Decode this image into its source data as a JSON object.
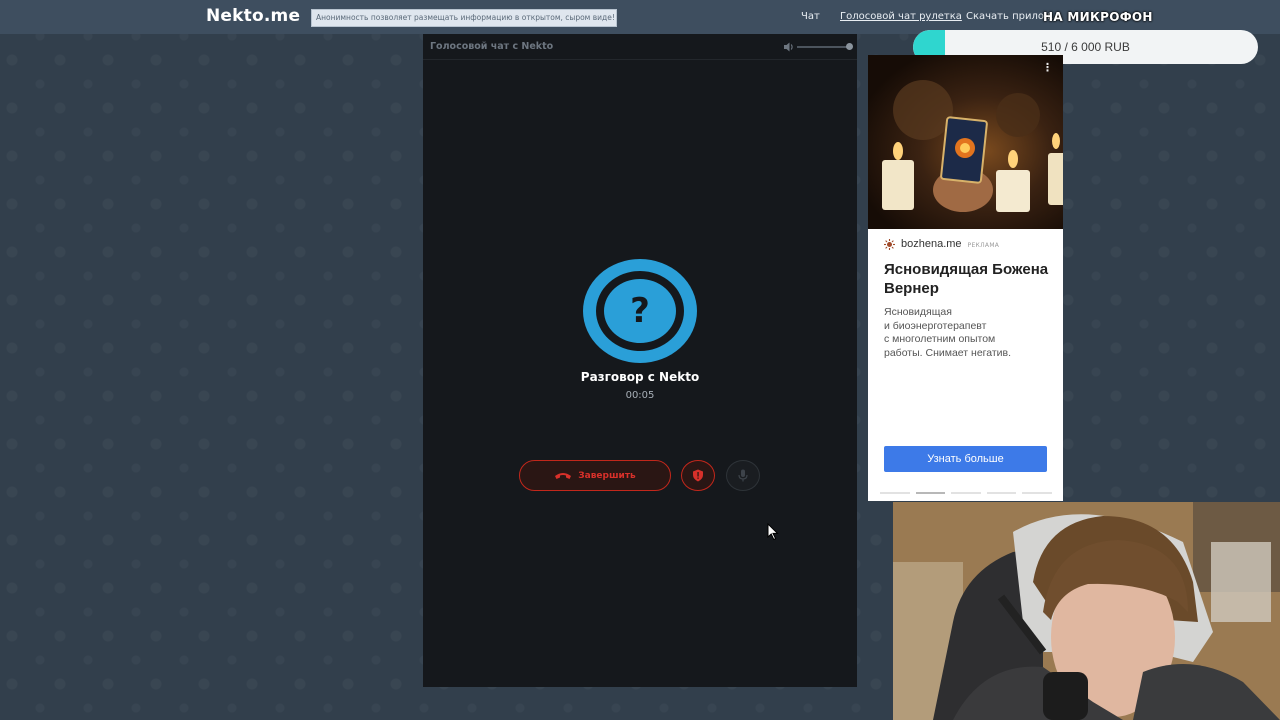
{
  "navbar": {
    "logo": "Nekto.me",
    "anon_notice": "Анонимность позволяет размещать информацию в открытом, сыром виде!",
    "links": [
      "Чат",
      "Голосовой чат рулетка",
      "Скачать прилож"
    ]
  },
  "stream_overlay": {
    "title": "НА МИКРОФОН",
    "donation_text": "510 / 6 000 RUB",
    "donation_progress": 0.085,
    "fill_color": "#2fd6cf"
  },
  "chat": {
    "header_title": "Голосовой чат с Nekto",
    "volume_level": 1.0,
    "avatar_symbol": "?",
    "caller_name": "Разговор с Nekto",
    "timer": "00:05",
    "end_button_label": "Завершить",
    "accent_color": "#2a9fd8",
    "danger_color": "#c2271b"
  },
  "ad": {
    "source": "bozhena.me",
    "label": "РЕКЛАМА",
    "title": "Ясновидящая Божена Вернер",
    "description": "Ясновидящая\nи биоэнерготерапевт\nс многолетним опытом\nработы. Снимает негатив.",
    "cta": "Узнать больше",
    "menu_icon": "⋮",
    "cta_color": "#3d7ae8"
  }
}
